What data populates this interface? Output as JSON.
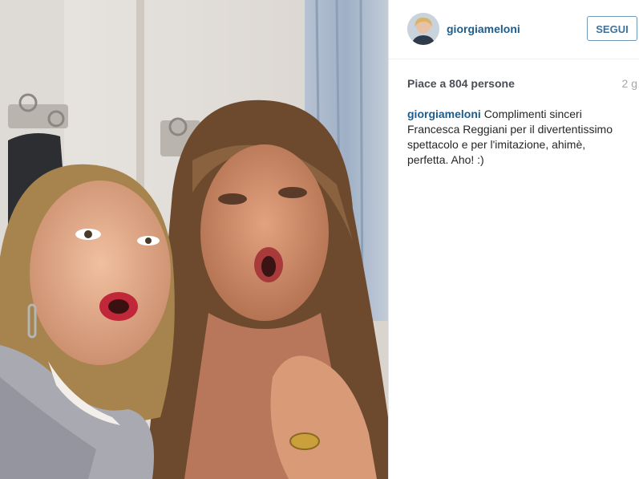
{
  "post": {
    "image_alt": "Selfie photo",
    "author": {
      "username": "giorgiameloni",
      "follow_label": "SEGUI"
    },
    "likes_text": "Piace a 804 persone",
    "time_ago": "2 g",
    "caption": {
      "username": "giorgiameloni",
      "text": "Complimenti sinceri Francesca Reggiani per il divertentissimo spettacolo e per l'imitazione, ahimè, perfetta. Aho! :)"
    }
  },
  "colors": {
    "link": "#1f5c8a",
    "follow_border": "#6f97b6",
    "follow_text": "#3f729b",
    "meta_text": "#4b4f54",
    "muted_text": "#a5a7aa"
  }
}
